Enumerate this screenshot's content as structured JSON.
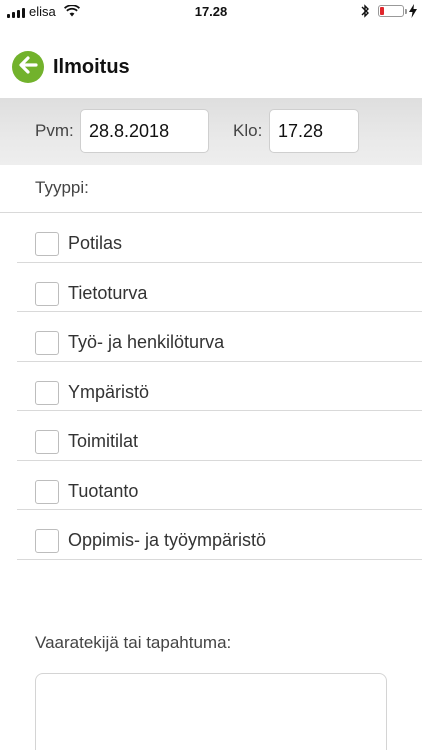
{
  "status_bar": {
    "carrier": "elisa",
    "time": "17.28",
    "battery_level_percent": 10
  },
  "header": {
    "title": "Ilmoitus",
    "back_icon": "arrow-left-icon",
    "accent_color": "#72b22c"
  },
  "date_row": {
    "date_label": "Pvm:",
    "date_value": "28.8.2018",
    "time_label": "Klo:",
    "time_value": "17.28"
  },
  "type_section": {
    "label": "Tyyppi:",
    "options": [
      {
        "label": "Potilas",
        "checked": false
      },
      {
        "label": "Tietoturva",
        "checked": false
      },
      {
        "label": "Työ- ja henkilöturva",
        "checked": false
      },
      {
        "label": "Ympäristö",
        "checked": false
      },
      {
        "label": "Toimitilat",
        "checked": false
      },
      {
        "label": "Tuotanto",
        "checked": false
      },
      {
        "label": "Oppimis- ja työympäristö",
        "checked": false
      }
    ]
  },
  "hazard_section": {
    "label": "Vaaratekijä tai tapahtuma:",
    "value": ""
  }
}
